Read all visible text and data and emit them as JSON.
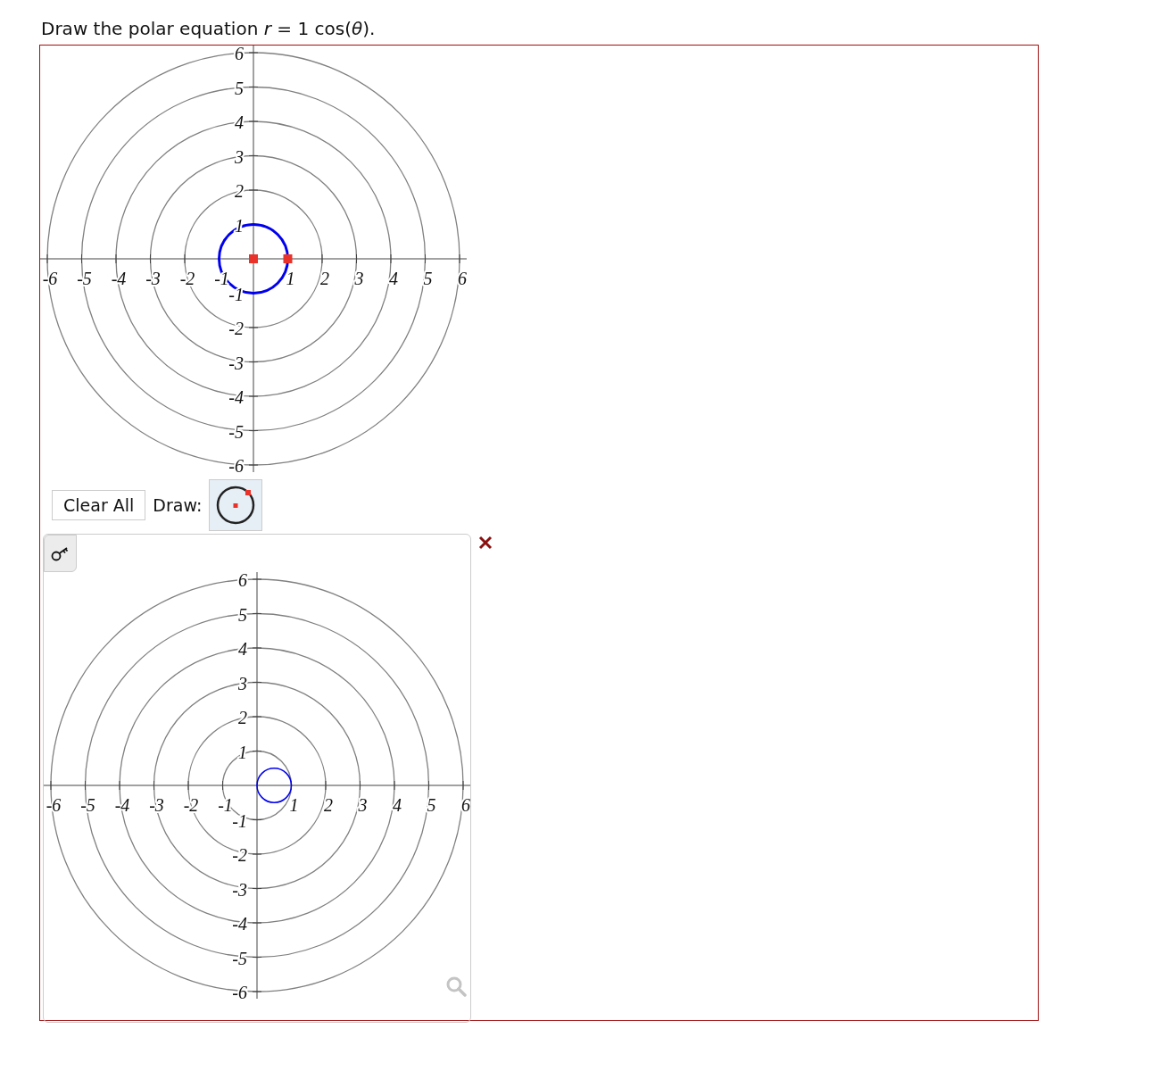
{
  "prompt": "Draw the polar equation *r* = 1 cos(*θ*).",
  "answer_graph": {
    "x_labels": [
      "-6",
      "-5",
      "-4",
      "-3",
      "-2",
      "-1",
      "1",
      "2",
      "3",
      "4",
      "5",
      "6"
    ],
    "y_labels": [
      "6",
      "5",
      "4",
      "3",
      "2",
      "1",
      "-1",
      "-2",
      "-3",
      "-4",
      "-5",
      "-6"
    ]
  },
  "toolbar": {
    "clear_button": "Clear All",
    "draw_label": "Draw:",
    "tools": [
      {
        "kind": "circle",
        "selected": true
      }
    ]
  },
  "feedback": {
    "correct": false
  },
  "solution_graph": {
    "x_labels": [
      "-6",
      "-5",
      "-4",
      "-3",
      "-2",
      "-1",
      "1",
      "2",
      "3",
      "4",
      "5",
      "6"
    ],
    "y_labels": [
      "6",
      "5",
      "4",
      "3",
      "2",
      "1",
      "-1",
      "-2",
      "-3",
      "-4",
      "-5",
      "-6"
    ]
  }
}
